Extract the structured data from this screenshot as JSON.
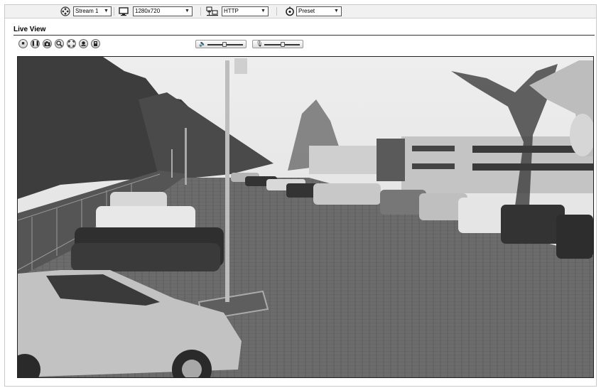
{
  "toolbar": {
    "stream": {
      "icon": "film-reel-icon",
      "value": "Stream 1"
    },
    "resolution": {
      "icon": "monitor-icon",
      "value": "1280x720"
    },
    "protocol": {
      "icon": "network-icon",
      "value": "HTTP"
    },
    "preset": {
      "icon": "ptz-preset-icon",
      "value": "Preset"
    }
  },
  "live_view": {
    "title": "Live View"
  },
  "controls": [
    {
      "name": "stop-button",
      "icon": "stop-icon"
    },
    {
      "name": "pause-button",
      "icon": "pause-icon"
    },
    {
      "name": "snapshot-button",
      "icon": "camera-icon"
    },
    {
      "name": "zoom-button",
      "icon": "magnifier-icon"
    },
    {
      "name": "fullscreen-button",
      "icon": "fullscreen-icon"
    },
    {
      "name": "manual-trigger-button",
      "icon": "trigger-icon"
    },
    {
      "name": "record-button",
      "icon": "record-icon"
    }
  ],
  "audio": {
    "speaker_volume": {
      "icon": "speaker-icon",
      "level": 0.45
    },
    "microphone_volume": {
      "icon": "microphone-icon",
      "level": 0.5
    }
  },
  "video": {
    "description_visible": false
  }
}
